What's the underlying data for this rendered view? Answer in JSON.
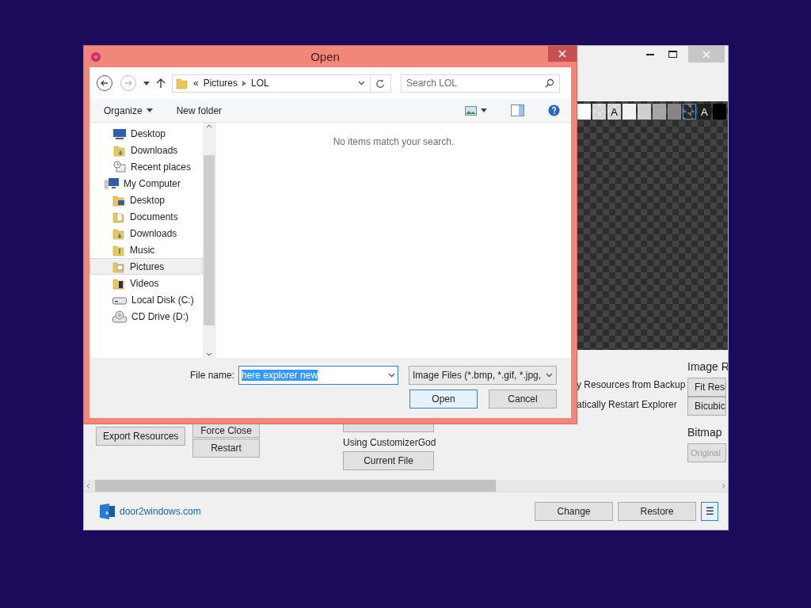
{
  "app_window": {
    "swatches": [
      {
        "kind": "solid",
        "color": "#ffffff",
        "selected": false
      },
      {
        "kind": "checker",
        "color": "#d6d6d6",
        "selected": false
      },
      {
        "kind": "checker",
        "color": "#d6d6d6",
        "label": "A",
        "selected": false
      },
      {
        "kind": "solid",
        "color": "#f2f2f2",
        "selected": false
      },
      {
        "kind": "solid",
        "color": "#cfcfcf",
        "selected": false
      },
      {
        "kind": "solid",
        "color": "#a6a6a6",
        "selected": false
      },
      {
        "kind": "solid",
        "color": "#858585",
        "selected": false
      },
      {
        "kind": "checker",
        "color": "#2b2b2b",
        "selected": true
      },
      {
        "kind": "solid",
        "color": "#1f1f1f",
        "label": "A",
        "selected": false
      },
      {
        "kind": "solid",
        "color": "#000000",
        "selected": false
      }
    ],
    "buttons_left": [
      "Export Resources"
    ],
    "buttons_middle": [
      "Force Close",
      "Restart"
    ],
    "customizer": {
      "label": "Using CustomizerGod",
      "button": "Current File"
    },
    "options": [
      "y Resources from Backup",
      "atically Restart Explorer"
    ],
    "image_resize": {
      "title": "Image R",
      "buttons": [
        "Fit Resi",
        "Bicubic"
      ]
    },
    "bitmap": {
      "title": "Bitmap",
      "button": {
        "label": "Original",
        "disabled": true
      }
    },
    "footer": {
      "link": "door2windows.com",
      "buttons": [
        "Change",
        "Restore"
      ],
      "menu": "☰"
    }
  },
  "dialog": {
    "title": "Open",
    "address": {
      "overflow": "«",
      "path": [
        "Pictures",
        "LOL"
      ]
    },
    "search": {
      "placeholder": "Search LOL"
    },
    "toolbar": {
      "organize": "Organize",
      "new_folder": "New folder"
    },
    "nav_pane": {
      "items": [
        {
          "label": "Desktop",
          "kind": "monitor",
          "selected": false
        },
        {
          "label": "Downloads",
          "kind": "downloads",
          "selected": false
        },
        {
          "label": "Recent places",
          "kind": "recent",
          "selected": false
        },
        {
          "label": "My Computer",
          "kind": "computer",
          "selected": false,
          "children": [
            {
              "label": "Desktop",
              "kind": "folder-desktop",
              "selected": false
            },
            {
              "label": "Documents",
              "kind": "folder-documents",
              "selected": false
            },
            {
              "label": "Downloads",
              "kind": "downloads",
              "selected": false
            },
            {
              "label": "Music",
              "kind": "folder-music",
              "selected": false
            },
            {
              "label": "Pictures",
              "kind": "folder-pictures",
              "selected": true
            },
            {
              "label": "Videos",
              "kind": "folder-videos",
              "selected": false
            },
            {
              "label": "Local Disk (C:)",
              "kind": "disk",
              "selected": false
            },
            {
              "label": "CD Drive (D:)",
              "kind": "cd",
              "selected": false
            }
          ]
        }
      ]
    },
    "empty_message": "No items match your search.",
    "file_name": {
      "label": "File name:",
      "value": "here explorer new",
      "text_selected": true
    },
    "file_type": {
      "value": "Image Files (*.bmp, *.gif, *.jpg,"
    },
    "buttons": [
      {
        "label": "Open",
        "default": true
      },
      {
        "label": "Cancel",
        "default": false
      }
    ]
  }
}
